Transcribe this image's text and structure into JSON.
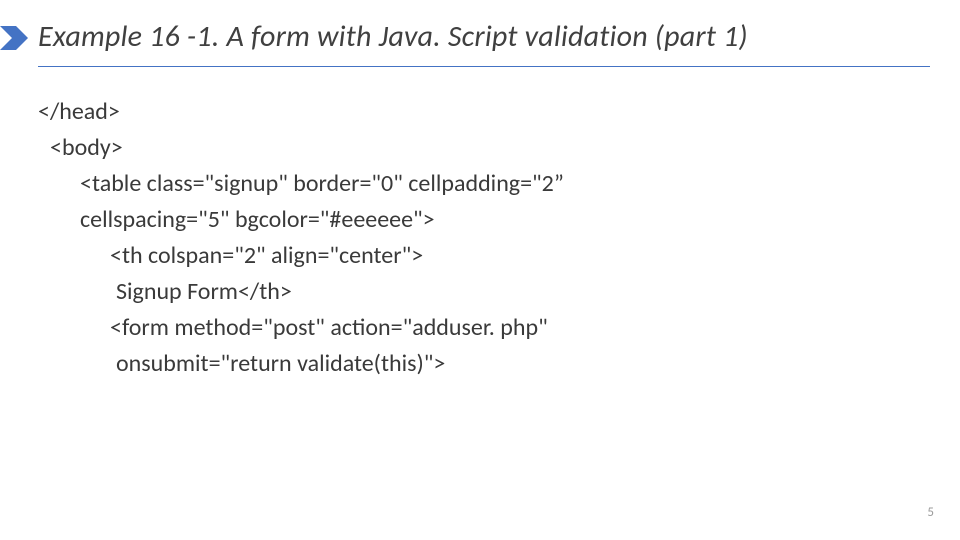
{
  "title": "Example 16 -1. A form with Java. Script validation (part 1)",
  "code": {
    "line1": "</head>",
    "line2": "<body>",
    "line3": "<table class=\"signup\" border=\"0\" cellpadding=\"2”",
    "line4": "cellspacing=\"5\" bgcolor=\"#eeeeee\">",
    "line5": "<th colspan=\"2\" align=\"center\">",
    "line6": "Signup Form</th>",
    "line7": "<form method=\"post\" action=\"adduser. php\"",
    "line8": "onsubmit=\"return validate(this)\">"
  },
  "page_number": "5"
}
